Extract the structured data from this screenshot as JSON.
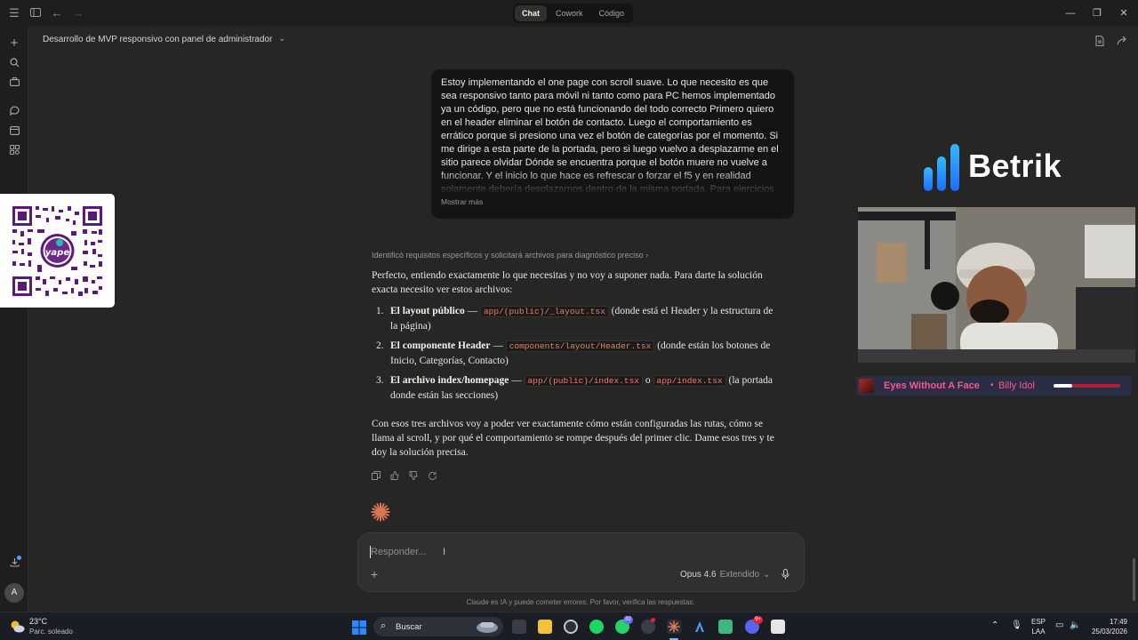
{
  "app": {
    "modes": [
      "Chat",
      "Cowork",
      "Código"
    ],
    "active_mode": "Chat",
    "conversation_title": "Desarrollo de MVP responsivo con panel de administrador"
  },
  "user_message": {
    "text": "Estoy implementando el one page con scroll suave. Lo que necesito es que sea responsivo tanto para móvil ni tanto como para PC hemos implementado ya un código, pero que no está funcionando del todo correcto Primero quiero en el header eliminar el botón de contacto. Luego el comportamiento es errático porque si presiono una vez el botón de categorías por el momento. Si me dirige a esta parte de la portada, pero si luego vuelvo a desplazarme en el sitio parece olvidar Dónde se encuentra porque el botón muere no vuelve a funcionar. Y el inicio lo que hace es refrescar o forzar el f5 y en realidad solamente debería desplazarnos dentro de la misma portada. Para ejercicios",
    "show_more": "Mostrar más"
  },
  "assistant": {
    "thinking_summary": "Identificó requisitos específicos y solicitará archivos para diagnóstico preciso",
    "intro": "Perfecto, entiendo exactamente lo que necesitas y no voy a suponer nada. Para darte la solución exacta necesito ver estos archivos:",
    "items": [
      {
        "num": "1.",
        "title": "El layout público",
        "dash": " — ",
        "code1": "app/(public)/_layout.tsx",
        "mid": "",
        "code2": "",
        "desc": " (donde está el Header y la estructura de la página)"
      },
      {
        "num": "2.",
        "title": "El componente Header",
        "dash": " — ",
        "code1": "components/layout/Header.tsx",
        "mid": "",
        "code2": "",
        "desc": " (donde están los botones de Inicio, Categorías, Contacto)"
      },
      {
        "num": "3.",
        "title": "El archivo index/homepage",
        "dash": " — ",
        "code1": "app/(public)/index.tsx",
        "mid": " o ",
        "code2": "app/index.tsx",
        "desc": " (la portada donde están las secciones)"
      }
    ],
    "closing": "Con esos tres archivos voy a poder ver exactamente cómo están configuradas las rutas, cómo se llama al scroll, y por qué el comportamiento se rompe después del primer clic. Dame esos tres y te doy la solución precisa."
  },
  "composer": {
    "placeholder": "Responder...",
    "model": "Opus 4.6",
    "mode": "Extendido",
    "disclaimer": "Claude es IA y puede cometer errores. Por favor, verifica las respuestas."
  },
  "user_avatar": "A",
  "overlays": {
    "brand": "Betrik",
    "qr_text": "yape",
    "now_playing": {
      "song": "Eyes Without A Face",
      "separator": "•",
      "artist": "Billy Idol",
      "progress": 0.28
    }
  },
  "taskbar": {
    "temperature": "23°C",
    "condition": "Parc. soleado",
    "search": "Buscar",
    "badge_whatsapp": "32",
    "badge_discord": "9+",
    "lang_1": "ESP",
    "lang_2": "LAA",
    "time": "17:49",
    "date": "25/03/2026"
  },
  "colors": {
    "background": "#262624",
    "bubble": "#141413",
    "code": "#e3806c",
    "accent": "#d97757",
    "now_playing": "#f45a8a"
  }
}
